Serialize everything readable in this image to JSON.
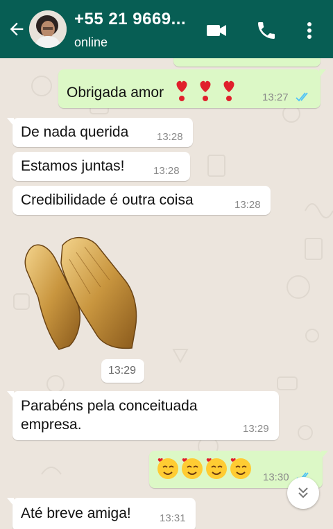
{
  "header": {
    "contact_name": "+55 21 9669...",
    "status": "online",
    "back_icon": "arrow-left-icon",
    "video_icon": "video-camera-icon",
    "call_icon": "phone-icon",
    "menu_icon": "more-vertical-icon"
  },
  "colors": {
    "header_bg": "#075e54",
    "chat_bg": "#ece5dd",
    "incoming_bubble": "#ffffff",
    "outgoing_bubble": "#dcf8c6",
    "read_ticks": "#4fc3f7"
  },
  "messages": [
    {
      "direction": "outgoing",
      "text": "Obrigada amor",
      "emoji": "❣❣❣",
      "time": "13:27",
      "ticks": "read"
    },
    {
      "direction": "incoming",
      "text": "De nada querida",
      "time": "13:28"
    },
    {
      "direction": "incoming",
      "text": "Estamos juntas!",
      "time": "13:28"
    },
    {
      "direction": "incoming",
      "text": "Credibilidade é outra coisa",
      "time": "13:28"
    },
    {
      "direction": "incoming",
      "type": "sticker",
      "sticker": "clapping-hands-sticker",
      "time": "13:29"
    },
    {
      "direction": "incoming",
      "text": "Parabéns pela conceituada\nempresa.",
      "time": "13:29"
    },
    {
      "direction": "outgoing",
      "emoji": "🥰🥰🥰🥰",
      "time": "13:30",
      "ticks": "read"
    },
    {
      "direction": "incoming",
      "text": "Até breve amiga!",
      "time": "13:31"
    }
  ],
  "scroll_down_icon": "double-chevron-down-icon"
}
